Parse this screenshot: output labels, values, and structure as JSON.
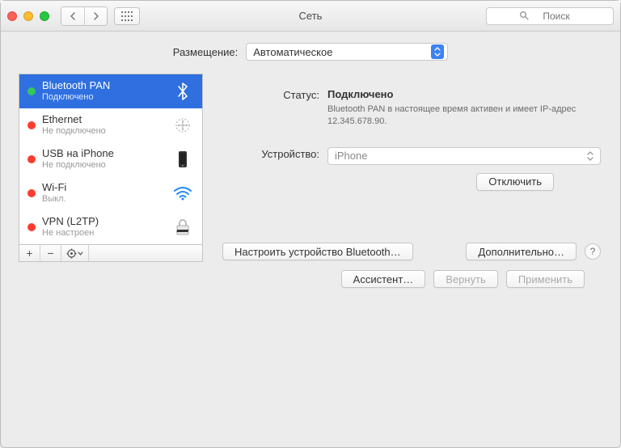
{
  "window": {
    "title": "Сеть"
  },
  "search": {
    "placeholder": "Поиск"
  },
  "location": {
    "label": "Размещение:",
    "value": "Автоматическое"
  },
  "sidebar": {
    "items": [
      {
        "name": "Bluetooth PAN",
        "status": "Подключено",
        "dot": "green"
      },
      {
        "name": "Ethernet",
        "status": "Не подключено",
        "dot": "red"
      },
      {
        "name": "USB на iPhone",
        "status": "Не подключено",
        "dot": "red"
      },
      {
        "name": "Wi-Fi",
        "status": "Выкл.",
        "dot": "red"
      },
      {
        "name": "VPN (L2TP)",
        "status": "Не настроен",
        "dot": "red"
      }
    ]
  },
  "detail": {
    "status_label": "Статус:",
    "status_value": "Подключено",
    "status_desc": "Bluetooth PAN в настоящее время активен и имеет IP-адрес 12.345.678.90.",
    "device_label": "Устройство:",
    "device_value": "iPhone",
    "disconnect": "Отключить",
    "configure_bt": "Настроить устройство Bluetooth…",
    "advanced": "Дополнительно…"
  },
  "footer": {
    "assistant": "Ассистент…",
    "revert": "Вернуть",
    "apply": "Применить"
  }
}
